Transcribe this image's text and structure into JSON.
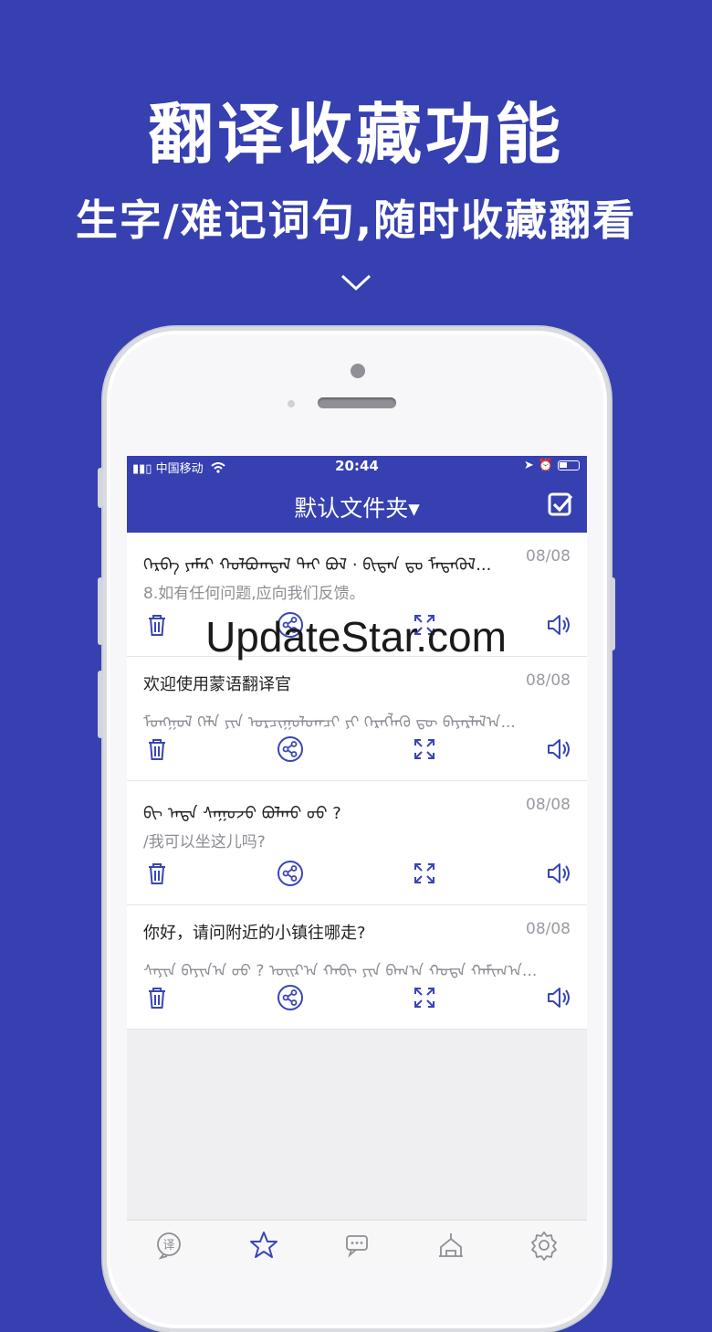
{
  "promo": {
    "headline": "翻译收藏功能",
    "subline": "生字/难记词句,随时收藏翻看"
  },
  "statusbar": {
    "carrier": "中国移动",
    "time": "20:44"
  },
  "navbar": {
    "title": "默认文件夹▾"
  },
  "items": [
    {
      "line1": "ᠬᠡᠷᠪᠡ ᠶᠠᠮᠠᠷ ᠬᠣᠯᠪᠣᠭᠳᠠᠯ ᠲᠠᠢ ᠪᠣᠯ · ᠪᠢᠳᠡᠨ ᠳᠤ ᠮᠡᠳᠡᠭᠦᠯ...",
      "date": "08/08",
      "line2": "8.如有任何问题,应向我们反馈。"
    },
    {
      "line1": "欢迎使用蒙语翻译官",
      "date": "08/08",
      "line2": "ᠮᠣᠩᠭᠣᠯ ᠬᠡᠯᠡ ᠶᠢᠨ ᠣᠷᠴᠢᠭᠤᠯᠤᠭᠴᠢ ᠶᠢ ᠬᠡᠷᠡᠭᠯᠡᠬᠦ ᠳᠦ ᠪᠠᠶᠠᠷᠯᠠᠯ᠎ᠠ..."
    },
    {
      "line1": "ᠪᠢ ᠡᠨᠳᠡ ᠰᠠᠭᠤᠵᠤ ᠪᠣᠯᠬᠤ ᠤᠤ ?",
      "date": "08/08",
      "line2": "/我可以坐这儿吗?"
    },
    {
      "line1": "你好，请问附近的小镇往哪走?",
      "date": "08/08",
      "line2": "ᠰᠠᠶᠢᠨ ᠪᠠᠶᠢᠨ᠎ᠠ ᠤᠤ ? ᠣᠢᠷ᠎ᠠ ᠬᠠᠪᠢ ᠶᠢᠨ ᠪᠠᠭ᠎ᠠ ᠬᠣᠲᠠ ᠬᠠᠮᠢᠭ᠎ᠠ..."
    }
  ],
  "tabs": [
    "translate-tab",
    "favorites-tab",
    "chat-tab",
    "culture-tab",
    "settings-tab"
  ],
  "watermark": "UpdateStar.com",
  "colors": {
    "brand": "#3640b0",
    "icon": "#3a45b5"
  }
}
